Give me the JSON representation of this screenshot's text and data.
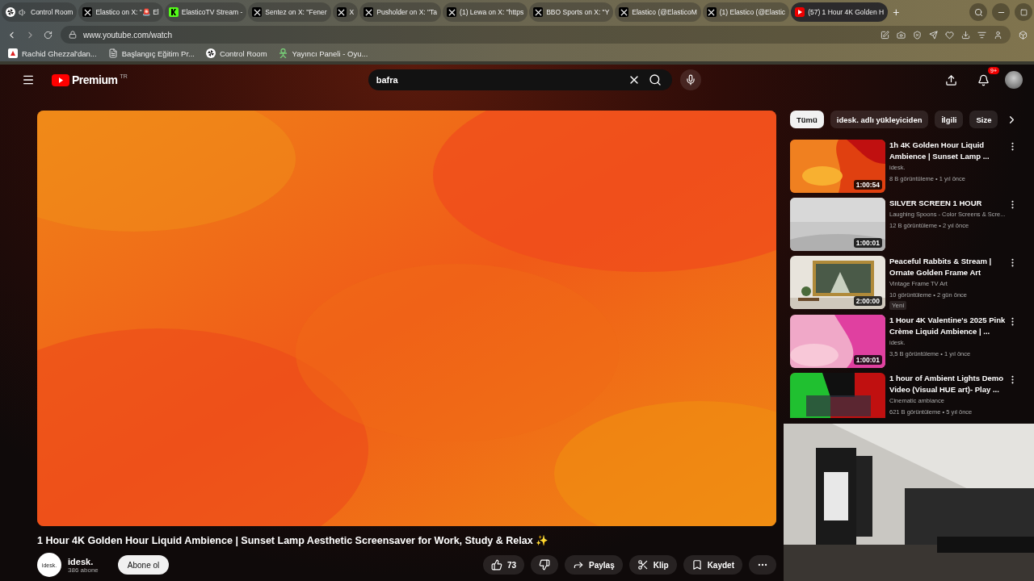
{
  "browser": {
    "tabs": [
      {
        "title": "Control Room",
        "kind": "app",
        "audio": true,
        "selected": false
      },
      {
        "title": "Elastico on X: \"🚨 El",
        "kind": "x",
        "audio": false,
        "selected": false
      },
      {
        "title": "ElasticoTV Stream - ",
        "kind": "kick",
        "audio": false,
        "selected": false
      },
      {
        "title": "Sentez on X: \"Fener",
        "kind": "x",
        "audio": false,
        "selected": false
      },
      {
        "title": "X",
        "kind": "x",
        "audio": false,
        "selected": false
      },
      {
        "title": "Pusholder on X: \"Ta",
        "kind": "x",
        "audio": false,
        "selected": false
      },
      {
        "title": "(1) Lewa on X: \"https",
        "kind": "x",
        "audio": false,
        "selected": false
      },
      {
        "title": "BBO Sports on X: \"Y",
        "kind": "x",
        "audio": false,
        "selected": false
      },
      {
        "title": "Elastico (@ElasticoM",
        "kind": "x",
        "audio": false,
        "selected": false
      },
      {
        "title": "(1) Elastico (@Elastic",
        "kind": "x",
        "audio": false,
        "selected": false
      },
      {
        "title": "(57) 1 Hour 4K Golden H",
        "kind": "youtube",
        "audio": false,
        "selected": true
      }
    ],
    "new_tab": "+",
    "address": "www.youtube.com/watch",
    "bookmarks": [
      {
        "label": "Rachid Ghezzal'dan...",
        "kind": "page"
      },
      {
        "label": "Başlangıç Eğitim Pr...",
        "kind": "doc"
      },
      {
        "label": "Control Room",
        "kind": "app"
      },
      {
        "label": "Yayıncı Paneli - Oyu...",
        "kind": "figure"
      }
    ]
  },
  "header": {
    "logo": "Premium",
    "region": "TR",
    "search": {
      "value": "bafra"
    },
    "notifications": "9+"
  },
  "chips": [
    {
      "label": "Tümü",
      "selected": true
    },
    {
      "label": "idesk. adlı yükleyiciden",
      "selected": false
    },
    {
      "label": "İlgili",
      "selected": false
    },
    {
      "label": "Size",
      "selected": false
    }
  ],
  "videos": [
    {
      "title": "1h 4K Golden Hour Liquid Ambience | Sunset Lamp ...",
      "channel": "idesk.",
      "meta": "8 B görüntüleme • 1 yıl önce",
      "duration": "1:00:54",
      "kind": "fire"
    },
    {
      "title": "SILVER SCREEN 1 HOUR",
      "channel": "Laughing Spoons - Color Screens & Scre...",
      "meta": "12 B görüntüleme • 2 yıl önce",
      "duration": "1:00:01",
      "kind": "silver"
    },
    {
      "title": "Peaceful Rabbits & Stream | Ornate Golden Frame Art",
      "channel": "Vintage Frame TV Art",
      "meta": "10 görüntüleme • 2 gün önce",
      "duration": "2:00:00",
      "badge": "Yeni",
      "kind": "frame"
    },
    {
      "title": "1 Hour 4K Valentine's 2025 Pink Crème Liquid Ambience | ...",
      "channel": "idesk.",
      "meta": "3,5 B görüntüleme • 1 yıl önce",
      "duration": "1:00:01",
      "kind": "pink"
    },
    {
      "title": "1 hour of Ambient Lights Demo Video (Visual HUE art)- Play ...",
      "channel": "Cinematic ambiance",
      "meta": "621 B görüntüleme • 5 yıl önce",
      "kind": "lights"
    }
  ],
  "title": "1 Hour 4K Golden Hour Liquid Ambience | Sunset Lamp Aesthetic Screensaver for Work, Study & Relax ✨",
  "channel": {
    "name": "idesk.",
    "subscribers": "386 abone",
    "avatar_text": "idesk.",
    "subscribe": "Abone ol"
  },
  "actions": {
    "likes": "73",
    "share": "Paylaş",
    "clip": "Klip",
    "save": "Kaydet"
  }
}
